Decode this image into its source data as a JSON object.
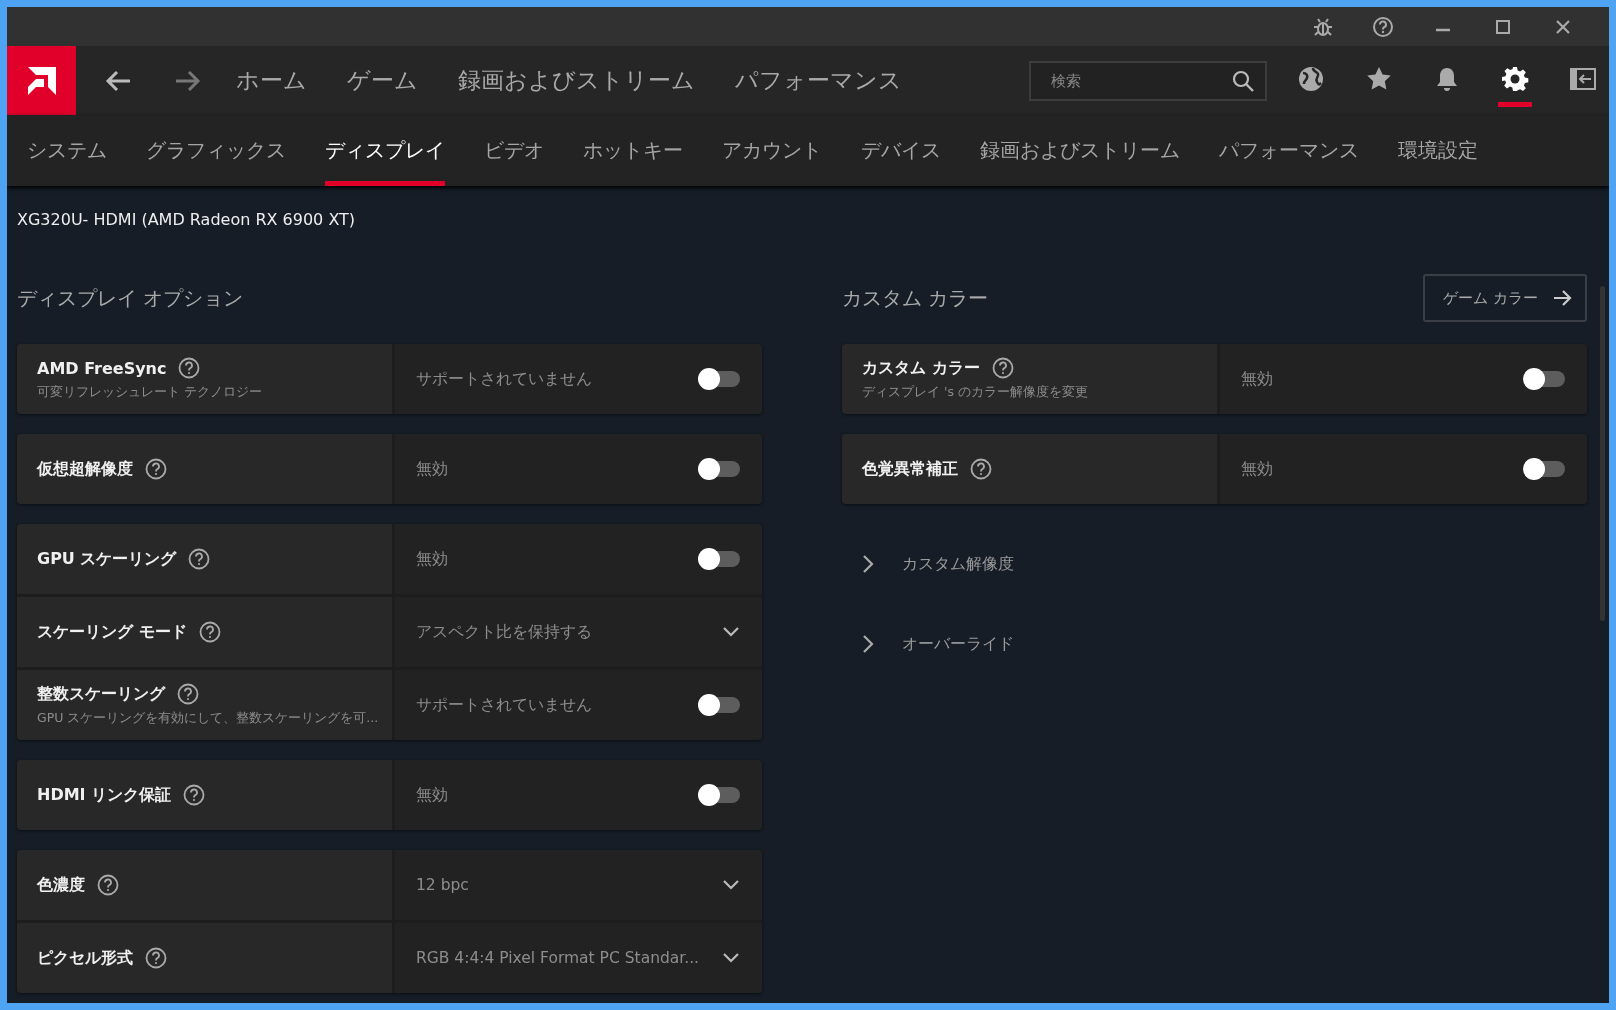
{
  "nav": {
    "items": [
      {
        "label": "ホーム"
      },
      {
        "label": "ゲーム"
      },
      {
        "label": "録画およびストリーム"
      },
      {
        "label": "パフォーマンス"
      }
    ],
    "search": {
      "placeholder": "検索"
    },
    "icons": [
      {
        "kind": "globe",
        "selected": false
      },
      {
        "kind": "star",
        "selected": false
      },
      {
        "kind": "bell",
        "selected": false
      },
      {
        "kind": "gear",
        "selected": true
      },
      {
        "kind": "panel",
        "selected": false
      }
    ]
  },
  "tabs": [
    {
      "label": "システム",
      "selected": false
    },
    {
      "label": "グラフィックス",
      "selected": false
    },
    {
      "label": "ディスプレイ",
      "selected": true
    },
    {
      "label": "ビデオ",
      "selected": false
    },
    {
      "label": "ホットキー",
      "selected": false
    },
    {
      "label": "アカウント",
      "selected": false
    },
    {
      "label": "デバイス",
      "selected": false
    },
    {
      "label": "録画およびストリーム",
      "selected": false
    },
    {
      "label": "パフォーマンス",
      "selected": false
    },
    {
      "label": "環境設定",
      "selected": false
    }
  ],
  "device": "XG320U- HDMI (AMD Radeon RX 6900 XT)",
  "display_options": {
    "title": "ディスプレイ オプション",
    "groups": [
      [
        {
          "label": "AMD FreeSync",
          "subtitle": "可変リフレッシュレート テクノロジー",
          "value": "サポートされていません",
          "kind": "toggle",
          "on": false
        }
      ],
      [
        {
          "label": "仮想超解像度",
          "value": "無効",
          "kind": "toggle",
          "on": false
        }
      ],
      [
        {
          "label": "GPU スケーリング",
          "value": "無効",
          "kind": "toggle",
          "on": false
        },
        {
          "label": "スケーリング モード",
          "value": "アスペクト比を保持する",
          "kind": "dropdown"
        },
        {
          "label": "整数スケーリング",
          "subtitle": "GPU スケーリングを有効にして、整数スケーリングを可...",
          "value": "サポートされていません",
          "kind": "toggle",
          "on": false
        }
      ],
      [
        {
          "label": "HDMI リンク保証",
          "value": "無効",
          "kind": "toggle",
          "on": false
        }
      ],
      [
        {
          "label": "色濃度",
          "value": "12 bpc",
          "kind": "dropdown"
        },
        {
          "label": "ピクセル形式",
          "value": "RGB 4:4:4 Pixel Format PC Standar...",
          "kind": "dropdown"
        }
      ]
    ]
  },
  "custom_color": {
    "title": "カスタム カラー",
    "button": "ゲーム カラー",
    "groups": [
      [
        {
          "label": "カスタム カラー",
          "subtitle": "ディスプレイ 's のカラー解像度を変更",
          "value": "無効",
          "kind": "toggle",
          "on": false
        }
      ],
      [
        {
          "label": "色覚異常補正",
          "value": "無効",
          "kind": "toggle",
          "on": false
        }
      ]
    ],
    "expanders": [
      {
        "label": "カスタム解像度",
        "expanded": false
      },
      {
        "label": "オーバーライド",
        "expanded": false
      }
    ]
  }
}
